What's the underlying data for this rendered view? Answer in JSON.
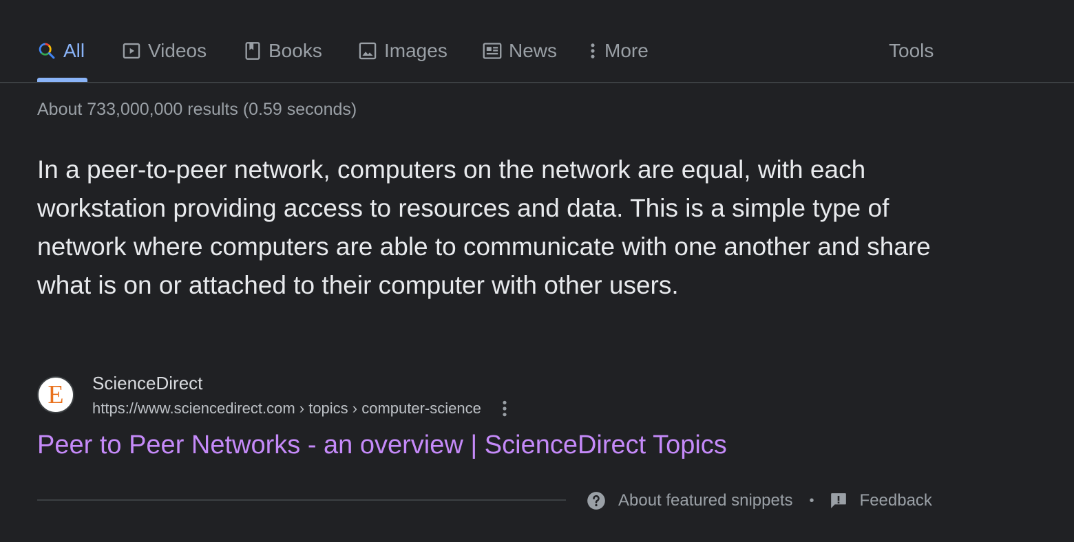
{
  "tabs": {
    "all": {
      "label": "All",
      "icon": "search-icon"
    },
    "videos": {
      "label": "Videos",
      "icon": "video-icon"
    },
    "books": {
      "label": "Books",
      "icon": "book-icon"
    },
    "images": {
      "label": "Images",
      "icon": "image-icon"
    },
    "news": {
      "label": "News",
      "icon": "news-icon"
    },
    "more": {
      "label": "More",
      "icon": "more-vert-icon"
    },
    "tools": {
      "label": "Tools"
    },
    "active": "All"
  },
  "results_stats": "About 733,000,000 results (0.59 seconds)",
  "snippet": {
    "text": "In a peer-to-peer network, computers on the network are equal, with each workstation providing access to resources and data. This is a simple type of network where computers are able to communicate with one another and share what is on or attached to their computer with other users."
  },
  "source": {
    "favicon_letter": "E",
    "name": "ScienceDirect",
    "url": "https://www.sciencedirect.com › topics › computer-science"
  },
  "result_title": "Peer to Peer Networks - an overview | ScienceDirect Topics",
  "footer": {
    "about_snippets": "About featured snippets",
    "separator": "•",
    "feedback": "Feedback"
  },
  "colors": {
    "background": "#202124",
    "active_tab": "#8ab4f8",
    "visited_link": "#c58af9",
    "muted_text": "#9aa0a6"
  }
}
